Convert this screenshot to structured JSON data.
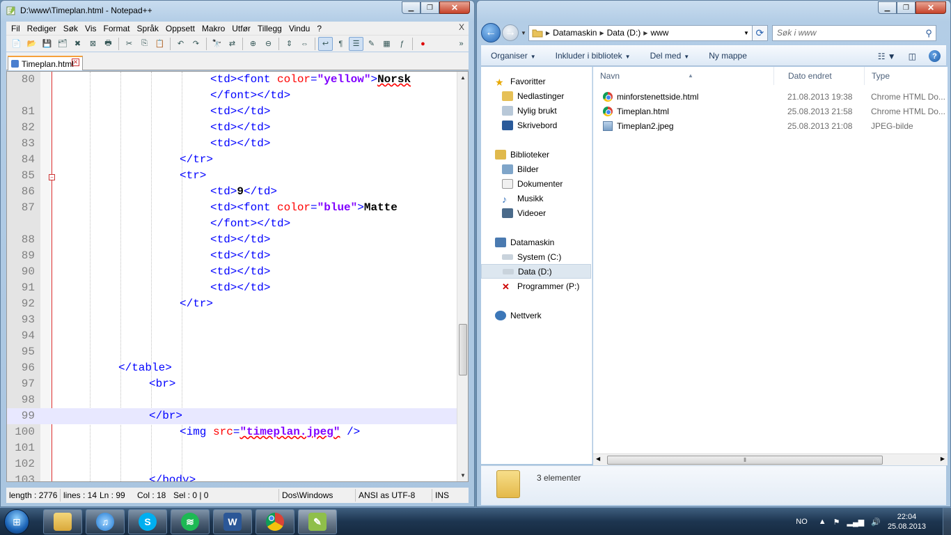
{
  "notepad": {
    "title": "D:\\www\\Timeplan.html - Notepad++",
    "menu": [
      "Fil",
      "Rediger",
      "Søk",
      "Vis",
      "Format",
      "Språk",
      "Oppsett",
      "Makro",
      "Utfør",
      "Tillegg",
      "Vindu",
      "?"
    ],
    "menu_close": "X",
    "tab_label": "Timeplan.html",
    "line_numbers": [
      "80",
      "",
      "81",
      "82",
      "83",
      "84",
      "85",
      "86",
      "87",
      "",
      "88",
      "89",
      "90",
      "91",
      "92",
      "93",
      "94",
      "95",
      "96",
      "97",
      "98",
      "99",
      "100",
      "101",
      "102",
      "103"
    ],
    "code": {
      "l80a_open": "<td><font ",
      "l80a_attr": "color",
      "l80a_eq": "=",
      "l80a_val": "\"yellow\"",
      "l80a_gt": ">",
      "l80a_text": "Norsk",
      "l80b": "</font></td>",
      "l81": "<td></td>",
      "l82": "<td></td>",
      "l83": "<td></td>",
      "l84": "</tr>",
      "l85": "<tr>",
      "l86_open": "<td>",
      "l86_text": "9",
      "l86_close": "</td>",
      "l87_open": "<td><font ",
      "l87_attr": "color",
      "l87_eq": "=",
      "l87_val": "\"blue\"",
      "l87_gt": ">",
      "l87_text": "Matte",
      "l87b": "</font></td>",
      "l88": "<td></td>",
      "l89": "<td></td>",
      "l90": "<td></td>",
      "l91": "<td></td>",
      "l92": "</tr>",
      "l96": "</table>",
      "l97": "<br>",
      "l99": "</br>",
      "l100_open": "<img ",
      "l100_attr": "src",
      "l100_eq": "=",
      "l100_val": "\"timeplan.jpeg\"",
      "l100_close": " />",
      "l103": "</body>"
    },
    "status": {
      "length": "length : 2776",
      "lines": "lines : 14",
      "ln": "Ln : 99",
      "col": "Col : 18",
      "sel": "Sel : 0 | 0",
      "eol": "Dos\\Windows",
      "encoding": "ANSI as UTF-8",
      "mode": "INS"
    }
  },
  "explorer": {
    "breadcrumb": [
      "Datamaskin",
      "Data (D:)",
      "www"
    ],
    "search_placeholder": "Søk i www",
    "commands": [
      "Organiser",
      "Inkluder i bibliotek",
      "Del med",
      "Ny mappe"
    ],
    "nav": {
      "favorites": "Favoritter",
      "downloads": "Nedlastinger",
      "recent": "Nylig brukt",
      "desktop": "Skrivebord",
      "libraries": "Biblioteker",
      "pictures": "Bilder",
      "documents": "Dokumenter",
      "music": "Musikk",
      "videos": "Videoer",
      "computer": "Datamaskin",
      "drive_c": "System (C:)",
      "drive_d": "Data (D:)",
      "drive_p": "Programmer (P:)",
      "network": "Nettverk"
    },
    "columns": {
      "name": "Navn",
      "date": "Dato endret",
      "type": "Type"
    },
    "files": [
      {
        "name": "minforstenettside.html",
        "date": "21.08.2013 19:38",
        "type": "Chrome HTML Do...",
        "icon": "chrome-icon"
      },
      {
        "name": "Timeplan.html",
        "date": "25.08.2013 21:58",
        "type": "Chrome HTML Do...",
        "icon": "chrome-icon"
      },
      {
        "name": "Timeplan2.jpeg",
        "date": "25.08.2013 21:08",
        "type": "JPEG-bilde",
        "icon": "jpeg-icon"
      }
    ],
    "item_count": "3 elementer"
  },
  "taskbar": {
    "language": "NO",
    "time": "22:04",
    "date": "25.08.2013",
    "apps": [
      "explorer",
      "itunes",
      "skype",
      "spotify",
      "word",
      "chrome",
      "notepad++"
    ]
  },
  "colors": {
    "tag": "#0000ff",
    "attribute": "#ff0000",
    "value": "#8000ff",
    "current_line": "#e8e8ff",
    "active_tab_accent": "#f6a13a"
  }
}
